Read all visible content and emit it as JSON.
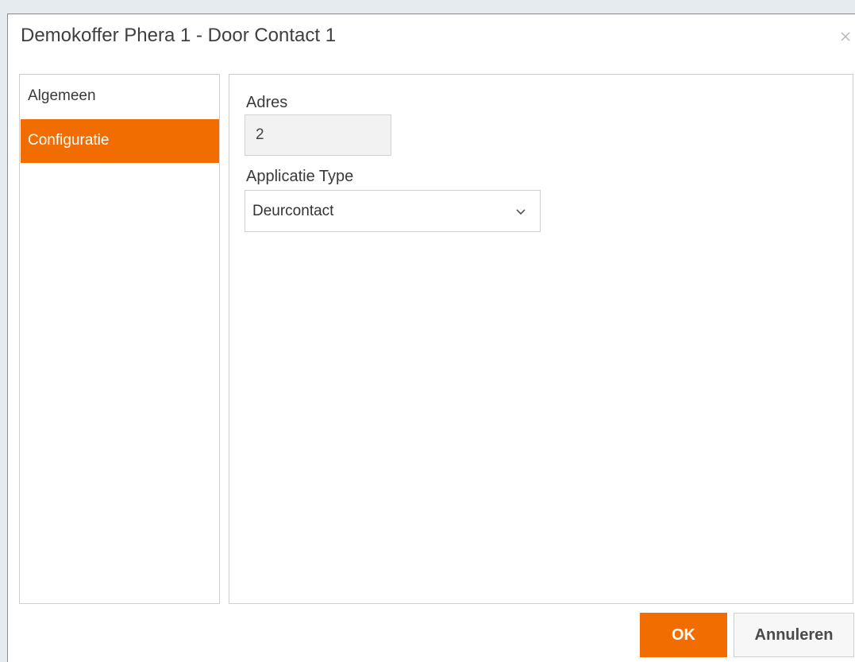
{
  "dialog": {
    "title": "Demokoffer Phera 1 - Door Contact 1",
    "close_icon": "close-icon"
  },
  "sidebar": {
    "items": [
      {
        "label": "Algemeen",
        "active": false
      },
      {
        "label": "Configuratie",
        "active": true
      }
    ]
  },
  "form": {
    "adres_label": "Adres",
    "adres_value": "2",
    "type_label": "Applicatie Type",
    "type_value": "Deurcontact",
    "type_icon": "chevron-down-icon"
  },
  "buttons": {
    "ok_label": "OK",
    "cancel_label": "Annuleren"
  },
  "colors": {
    "accent": "#f26d00",
    "window_border": "#6a90c3",
    "background": "#e6ebef"
  }
}
